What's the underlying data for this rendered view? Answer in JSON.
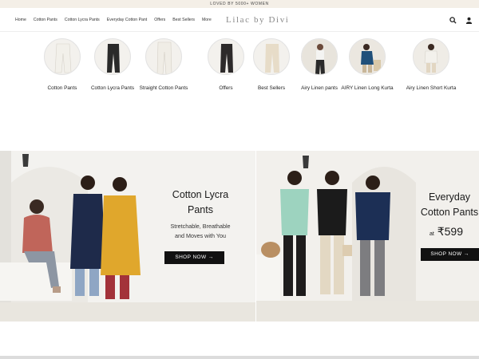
{
  "announcement": "LOVED BY 5000+ WOMEN",
  "nav": {
    "items": [
      "Home",
      "Cotton Pants",
      "Cotton Lycra Pants",
      "Everyday Cotton Pant",
      "Offers",
      "Best Sellers",
      "More"
    ]
  },
  "brand": {
    "logo": "Lilac by Divi"
  },
  "header_icons": [
    "search-icon",
    "user-icon"
  ],
  "categories": [
    {
      "label": "Cotton Pants",
      "pant_color": "#f2f0ea"
    },
    {
      "label": "Cotton Lycra Pants",
      "pant_color": "#2a2a2a"
    },
    {
      "label": "Straight Cotton Pants",
      "pant_color": "#f0ede6"
    },
    {
      "label": "Offers",
      "pant_color": "#2d2a2a"
    },
    {
      "label": "Best Sellers",
      "pant_color": "#e7dcc8"
    },
    {
      "label": "Airy Linen pants",
      "pant_color": "#2a2a2a"
    },
    {
      "label": "AIRY Linen Long Kurta",
      "pant_color": "#1f4f7a"
    },
    {
      "label": "Airy Linen Short Kurta",
      "pant_color": "#f3f1ec"
    }
  ],
  "banners": [
    {
      "title_line1": "Cotton Lycra",
      "title_line2": "Pants",
      "subtitle_line1": "Stretchable, Breathable",
      "subtitle_line2": "and Moves with You",
      "cta": "SHOP NOW →"
    },
    {
      "title_line1": "Everyday",
      "title_line2": "Cotton Pants",
      "price_prefix": "at",
      "price": "₹599",
      "cta": "SHOP NOW →"
    }
  ],
  "colors": {
    "accent": "#111111",
    "announce_bg": "#f4efe7",
    "logo": "#8a8a8a"
  }
}
